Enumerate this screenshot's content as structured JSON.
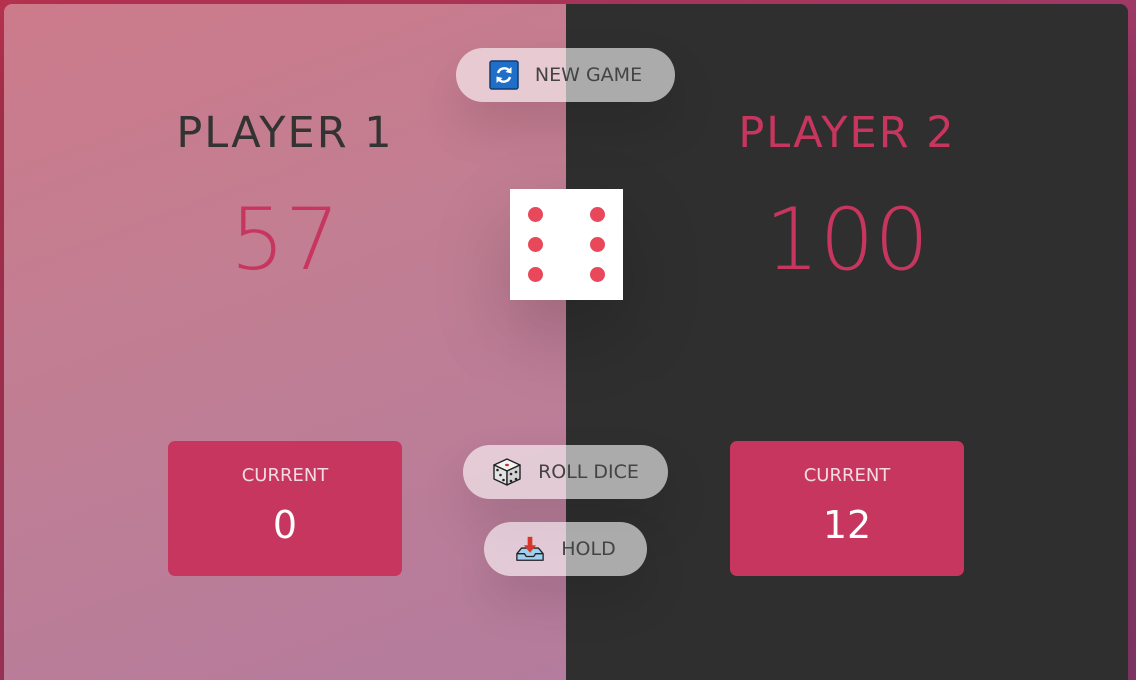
{
  "players": [
    {
      "name": "PLAYER 1",
      "score": "57",
      "current_label": "CURRENT",
      "current_score": "0",
      "active": true
    },
    {
      "name": "PLAYER 2",
      "score": "100",
      "current_label": "CURRENT",
      "current_score": "12",
      "active": false
    }
  ],
  "buttons": {
    "new_game": {
      "label": "NEW GAME",
      "icon": "refresh-icon"
    },
    "roll_dice": {
      "label": "ROLL DICE",
      "icon": "game-die-icon"
    },
    "hold": {
      "label": "HOLD",
      "icon": "inbox-tray-icon"
    }
  },
  "dice": {
    "value": 6
  },
  "colors": {
    "accent": "#c7365f",
    "pip": "#e8485a",
    "dark_panel": "#2f2f2f"
  }
}
